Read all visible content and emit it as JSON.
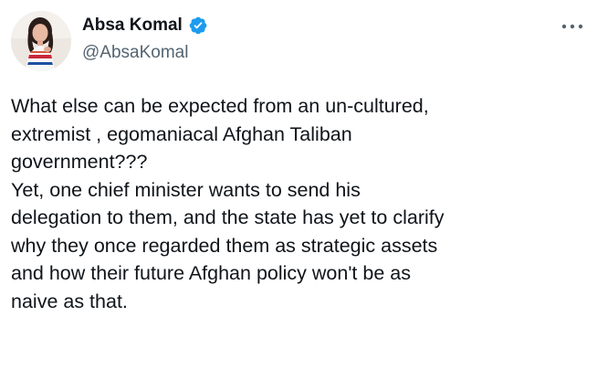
{
  "author": {
    "display_name": "Absa Komal",
    "handle": "@AbsaKomal",
    "verified": true,
    "verified_color": "#1d9bf0"
  },
  "menu": {
    "icon": "more-horizontal-icon"
  },
  "tweet": {
    "lines": [
      "What else can be expected from an un-cultured,",
      "extremist , egomaniacal Afghan Taliban",
      "government???",
      "Yet, one chief minister wants to send his",
      "delegation to them, and the state has yet to clarify",
      "why they once regarded them as strategic assets",
      "and how their future Afghan policy won't be as",
      "naive as that."
    ]
  },
  "colors": {
    "text_primary": "#0f1419",
    "text_secondary": "#536471",
    "background": "#ffffff"
  }
}
